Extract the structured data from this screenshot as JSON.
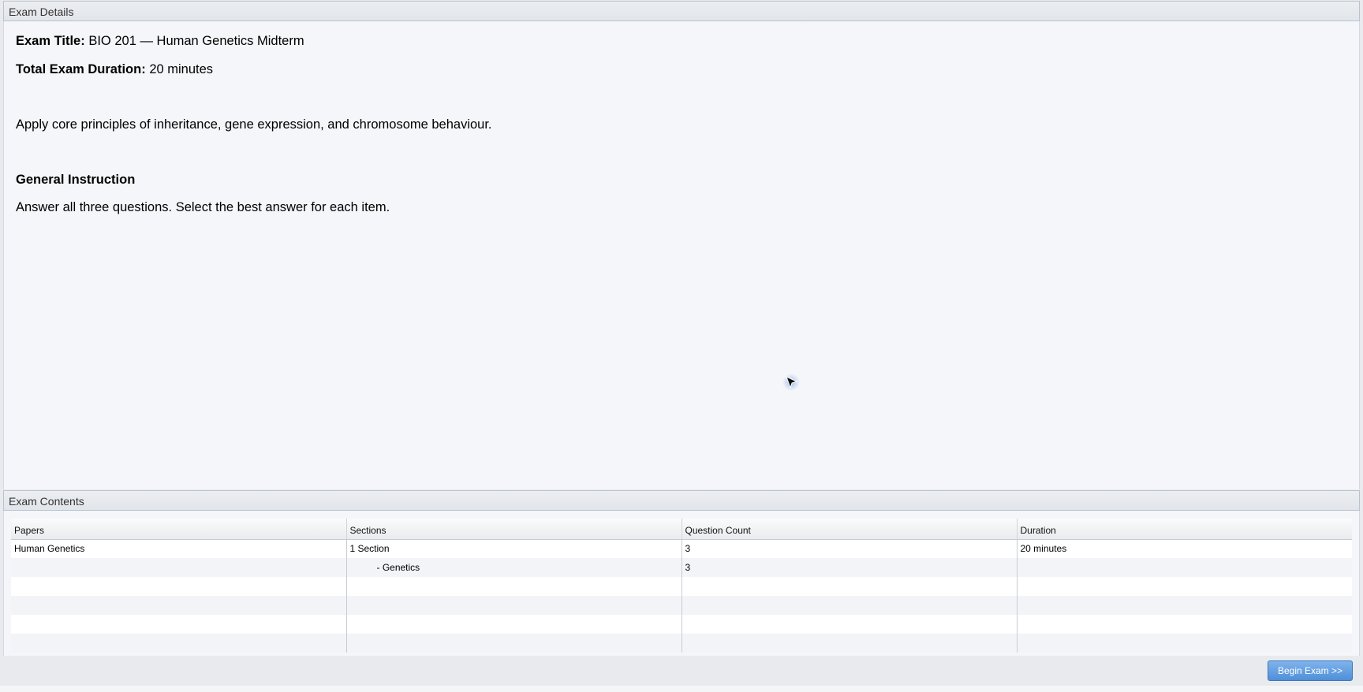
{
  "details": {
    "header": "Exam Details",
    "title_label": "Exam Title:",
    "title_value": "BIO 201 — Human Genetics Midterm",
    "duration_label": "Total Exam Duration:",
    "duration_value": "20 minutes",
    "description": "Apply core principles of inheritance, gene expression, and chromosome behaviour.",
    "general_instruction_heading": "General Instruction",
    "general_instruction_text": "Answer all three questions. Select the best answer for each item."
  },
  "contents": {
    "header": "Exam Contents",
    "columns": [
      "Papers",
      "Sections",
      "Question Count",
      "Duration"
    ],
    "rows": [
      {
        "paper": "Human Genetics",
        "section": "1 Section",
        "count": "3",
        "duration": "20 minutes"
      },
      {
        "paper": "",
        "section": "- Genetics",
        "count": "3",
        "duration": ""
      }
    ]
  },
  "footer": {
    "begin_label": "Begin Exam >>"
  },
  "icons": {
    "cursor": "mouse-pointer-icon"
  },
  "colors": {
    "button": "#5b9be0",
    "panel_bg": "#f4f6f9"
  }
}
